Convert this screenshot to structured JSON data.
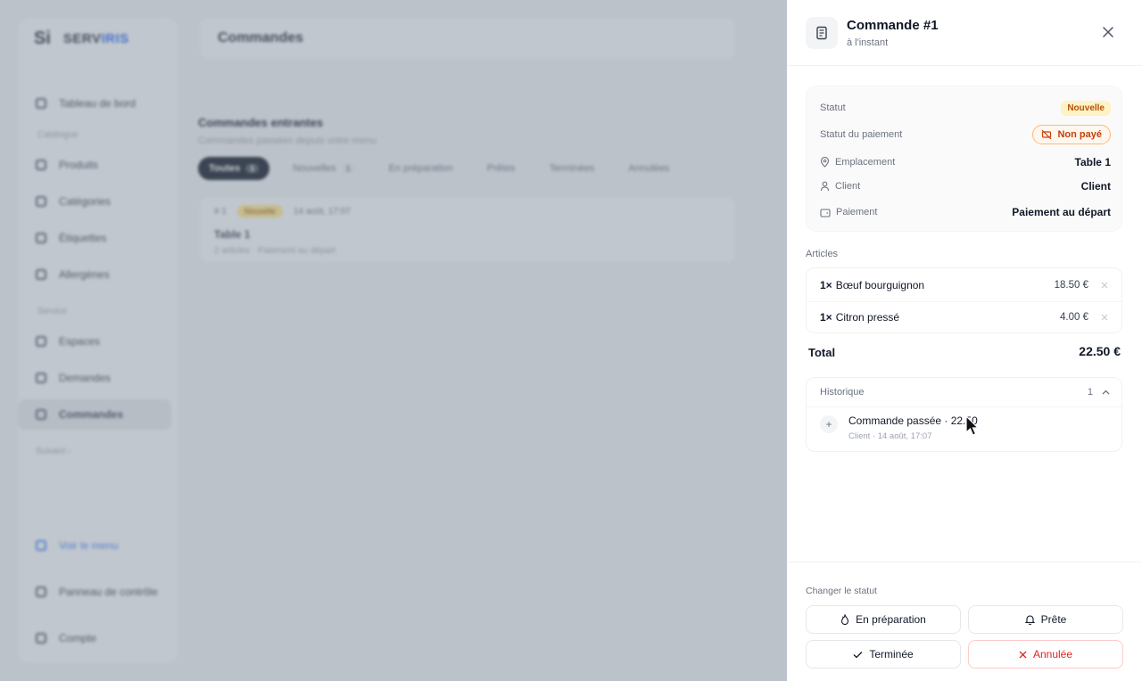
{
  "app": {
    "brand_logo": "Si",
    "brand_name_a": "SERV",
    "brand_name_b": "IRIS",
    "page_title": "Commandes",
    "nav": {
      "dashboard": "Tableau de bord",
      "section_catalog": "Catalogue",
      "products": "Produits",
      "categories": "Catégories",
      "tags": "Étiquettes",
      "allergens": "Allergènes",
      "section_service": "Service",
      "spaces": "Espaces",
      "requests": "Demandes",
      "orders": "Commandes",
      "more": "Suivant ›",
      "view_menu": "Voir le menu",
      "control_panel": "Panneau de contrôle",
      "account": "Compte"
    },
    "incoming": {
      "title": "Commandes entrantes",
      "subtitle": "Commandes passées depuis votre menu",
      "filters": [
        {
          "label": "Toutes",
          "count": "1"
        },
        {
          "label": "Nouvelles",
          "count": "1"
        },
        {
          "label": "En préparation",
          "count": ""
        },
        {
          "label": "Prêtes",
          "count": ""
        },
        {
          "label": "Terminées",
          "count": ""
        },
        {
          "label": "Annulées",
          "count": ""
        }
      ],
      "card": {
        "number": "# 1",
        "status": "Nouvelle",
        "time": "14 août, 17:07",
        "title": "Table 1",
        "sub": "2 articles · Paiement au départ"
      }
    }
  },
  "drawer": {
    "title": "Commande #1",
    "subtitle": "à l'instant",
    "info": {
      "status_label": "Statut",
      "status_value": "Nouvelle",
      "payment_status_label": "Statut du paiement",
      "payment_status_value": "Non payé",
      "location_label": "Emplacement",
      "location_value": "Table 1",
      "client_label": "Client",
      "client_value": "Client",
      "payment_label": "Paiement",
      "payment_value": "Paiement au départ"
    },
    "articles_label": "Articles",
    "articles": [
      {
        "qty": "1×",
        "name": "Bœuf bourguignon",
        "price": "18.50 €"
      },
      {
        "qty": "1×",
        "name": "Citron pressé",
        "price": "4.00 €"
      }
    ],
    "total_label": "Total",
    "total_value": "22.50 €",
    "history": {
      "label": "Historique",
      "count": "1",
      "item_title": "Commande passée · 22.50",
      "item_meta": "Client · 14 août, 17:07"
    },
    "footer": {
      "label": "Changer le statut",
      "btn_preparing": "En préparation",
      "btn_ready": "Prête",
      "btn_done": "Terminée",
      "btn_cancelled": "Annulée"
    }
  },
  "colors": {
    "accent": "#2563eb",
    "status_new": "#b45309",
    "unpaid": "#c2410c",
    "danger": "#dc2626"
  }
}
